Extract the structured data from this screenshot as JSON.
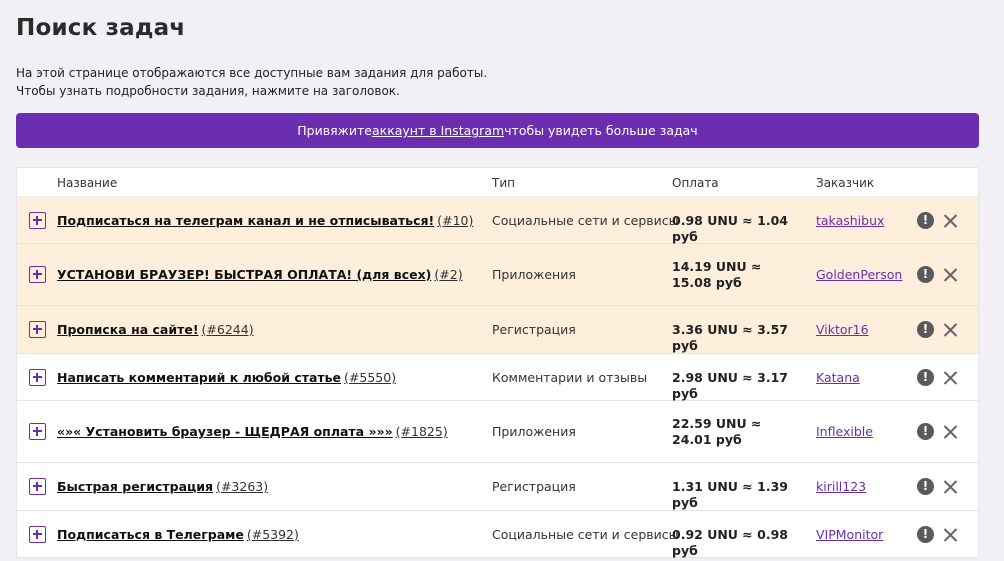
{
  "page": {
    "title": "Поиск задач",
    "intro_line1": "На этой странице отображаются все доступные вам задания для работы.",
    "intro_line2": "Чтобы узнать подробности задания, нажмите на заголовок."
  },
  "banner": {
    "prefix": "Привяжите ",
    "link": "аккаунт в Instagram",
    "suffix": " чтобы увидеть больше задач",
    "color": "#6b2eb0"
  },
  "table": {
    "headers": {
      "name": "Название",
      "type": "Тип",
      "pay": "Оплата",
      "customer": "Заказчик"
    },
    "rows": [
      {
        "title": "Подписаться на телеграм канал и не отписываться!",
        "num": "(#10)",
        "type": "Социальные сети и сервисы",
        "pay": "0.98 UNU ≈ 1.04 руб",
        "customer": "takashibux",
        "highlighted": true
      },
      {
        "title": "УСТАНОВИ БРАУЗЕР! БЫСТРАЯ ОПЛАТА! (для всех)",
        "num": "(#2)",
        "type": "Приложения",
        "pay": "14.19 UNU ≈ 15.08 руб",
        "customer": "GoldenPerson",
        "highlighted": true
      },
      {
        "title": "Прописка на сайте!",
        "num": "(#6244)",
        "type": "Регистрация",
        "pay": "3.36 UNU ≈ 3.57 руб",
        "customer": "Viktor16",
        "highlighted": true
      },
      {
        "title": "Написать комментарий к любой статье",
        "num": "(#5550)",
        "type": "Комментарии и отзывы",
        "pay": "2.98 UNU ≈ 3.17 руб",
        "customer": "Katana",
        "highlighted": false
      },
      {
        "title": "«»« Установить браузер - ЩЕДРАЯ оплата »»»",
        "num": "(#1825)",
        "type": "Приложения",
        "pay": "22.59 UNU ≈ 24.01 руб",
        "customer": "Inflexible",
        "highlighted": false
      },
      {
        "title": "Быстрая регистрация",
        "num": "(#3263)",
        "type": "Регистрация",
        "pay": "1.31 UNU ≈ 1.39 руб",
        "customer": "kirill123",
        "highlighted": false
      },
      {
        "title": "Подписаться в Телеграме",
        "num": "(#5392)",
        "type": "Социальные сети и сервисы",
        "pay": "0.92 UNU ≈ 0.98 руб",
        "customer": "VIPMonitor",
        "highlighted": false
      }
    ],
    "row_icons": {
      "expand": "plus-square-icon",
      "report": "exclamation-circle-icon",
      "hide": "close-icon"
    },
    "highlight_color": "#fdefdc"
  }
}
